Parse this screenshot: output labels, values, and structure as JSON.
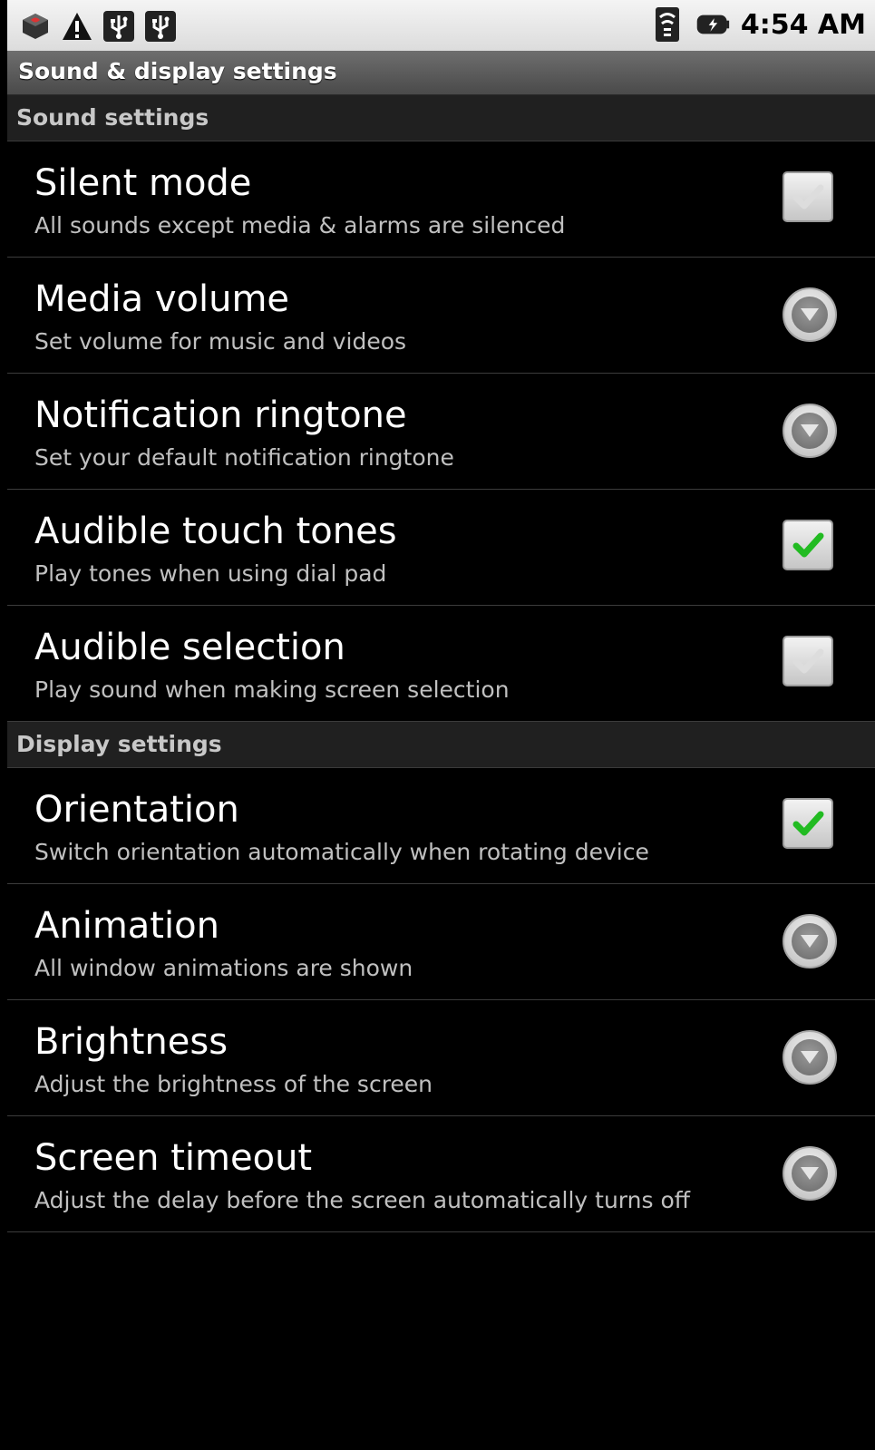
{
  "status_bar": {
    "time": "4:54 AM",
    "left_icons": [
      "app-notification-icon",
      "warning-icon",
      "usb-icon",
      "usb-icon"
    ],
    "right_icons": [
      "wifi-signal-icon",
      "battery-charging-icon"
    ]
  },
  "title_bar": {
    "title": "Sound & display settings"
  },
  "sections": [
    {
      "header": "Sound settings",
      "items": [
        {
          "title": "Silent mode",
          "summary": "All sounds except media & alarms are silenced",
          "widget": "checkbox",
          "checked": false
        },
        {
          "title": "Media volume",
          "summary": "Set volume for music and videos",
          "widget": "dropdown"
        },
        {
          "title": "Notification ringtone",
          "summary": "Set your default notification ringtone",
          "widget": "dropdown"
        },
        {
          "title": "Audible touch tones",
          "summary": "Play tones when using dial pad",
          "widget": "checkbox",
          "checked": true
        },
        {
          "title": "Audible selection",
          "summary": "Play sound when making screen selection",
          "widget": "checkbox",
          "checked": false
        }
      ]
    },
    {
      "header": "Display settings",
      "items": [
        {
          "title": "Orientation",
          "summary": "Switch orientation automatically when rotating device",
          "widget": "checkbox",
          "checked": true
        },
        {
          "title": "Animation",
          "summary": "All window animations are shown",
          "widget": "dropdown"
        },
        {
          "title": "Brightness",
          "summary": "Adjust the brightness of the screen",
          "widget": "dropdown"
        },
        {
          "title": "Screen timeout",
          "summary": "Adjust the delay before the screen automatically turns off",
          "widget": "dropdown"
        }
      ]
    }
  ],
  "colors": {
    "check_on": "#22bb22",
    "check_off": "#dddddd",
    "background": "#000000"
  }
}
